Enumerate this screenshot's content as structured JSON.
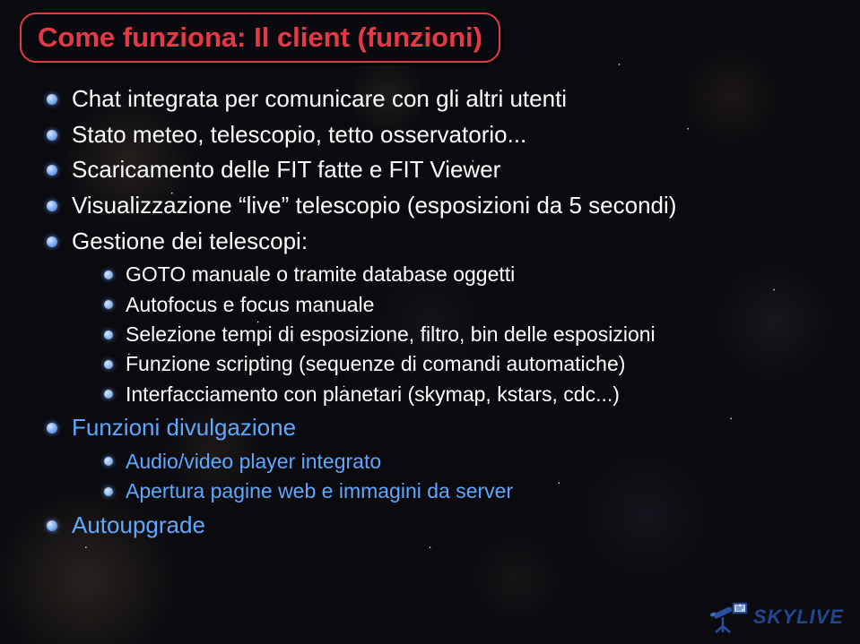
{
  "title": "Come funziona: Il client (funzioni)",
  "bullets": {
    "b1": "Chat integrata per comunicare con gli altri utenti",
    "b2": "Stato meteo, telescopio, tetto osservatorio...",
    "b3": "Scaricamento delle FIT fatte e FIT Viewer",
    "b4": "Visualizzazione “live” telescopio (esposizioni da 5 secondi)",
    "b5": "Gestione dei telescopi:",
    "b5_1": "GOTO manuale o tramite database oggetti",
    "b5_2": "Autofocus e focus manuale",
    "b5_3": "Selezione tempi di esposizione, filtro, bin delle esposizioni",
    "b5_4": "Funzione scripting (sequenze di comandi automatiche)",
    "b5_5": "Interfacciamento con planetari (skymap, kstars, cdc...)",
    "b6": "Funzioni divulgazione",
    "b6_1": "Audio/video player integrato",
    "b6_2": "Apertura pagine web e immagini da server",
    "b7": "Autoupgrade"
  },
  "logo_text": "SKYLIVE"
}
